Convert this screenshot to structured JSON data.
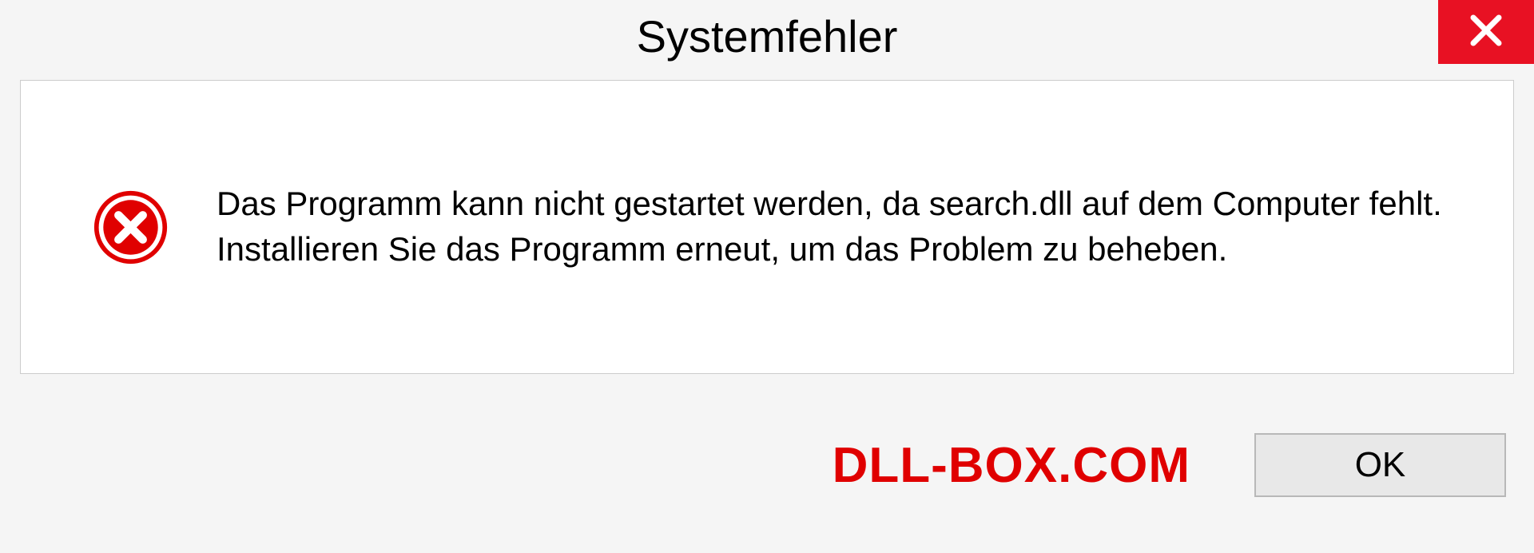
{
  "dialog": {
    "title": "Systemfehler",
    "message": "Das Programm kann nicht gestartet werden, da search.dll auf dem Computer fehlt. Installieren Sie das Programm erneut, um das Problem zu beheben.",
    "ok_label": "OK"
  },
  "watermark": "DLL-BOX.COM",
  "colors": {
    "close_button": "#e81123",
    "error_icon": "#e00000",
    "watermark": "#e00000"
  }
}
